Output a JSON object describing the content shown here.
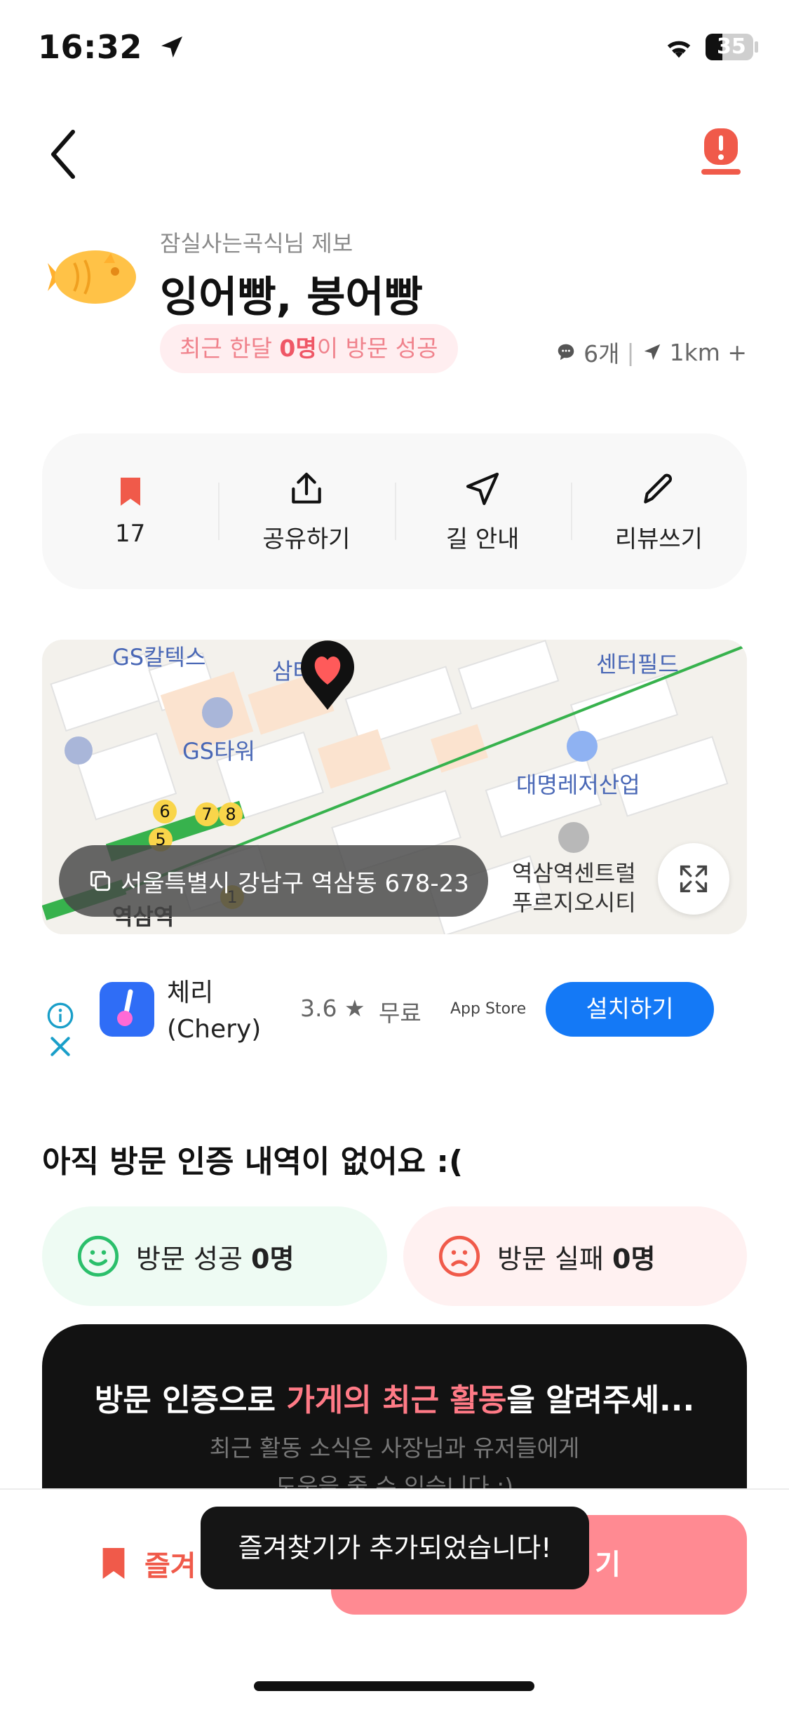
{
  "status_bar": {
    "time": "16:32",
    "battery": "35"
  },
  "header": {
    "back_icon": "chevron-left-icon",
    "report_icon": "alert-icon"
  },
  "store": {
    "tipster": "잠실사는곡식님 제보",
    "name": "잉어빵, 붕어빵",
    "visit_pill_prefix": "최근 한달 ",
    "visit_pill_count": "0명",
    "visit_pill_suffix": "이 방문 성공",
    "review_count": "6개",
    "distance": "1km +"
  },
  "actions": [
    {
      "icon": "bookmark-icon",
      "label": "17"
    },
    {
      "icon": "share-icon",
      "label": "공유하기"
    },
    {
      "icon": "navigation-icon",
      "label": "길 안내"
    },
    {
      "icon": "pencil-icon",
      "label": "리뷰쓰기"
    }
  ],
  "map": {
    "labels": [
      "GS칼텍스",
      "삼타워",
      "센터필드",
      "GS타워",
      "대명레저산업",
      "역삼역센트럴",
      "푸르지오시티",
      "역삼역"
    ],
    "exits": [
      "6",
      "7",
      "8",
      "5",
      "1"
    ],
    "address": "서울특별시 강남구 역삼동 678-23"
  },
  "ad": {
    "app_name_line1": "체리",
    "app_name_line2": "(Chery)",
    "rating": "3.6 ★",
    "price": "무료",
    "store": "App Store",
    "install": "설치하기"
  },
  "visits": {
    "heading": "아직 방문 인증 내역이 없어요 :(",
    "success_label": "방문 성공 ",
    "success_count": "0명",
    "fail_label": "방문 실패 ",
    "fail_count": "0명"
  },
  "promo": {
    "title_part1": "방문 인증으로 ",
    "title_highlight": "가게의 최근 활동",
    "title_part2": "을 알려주세...",
    "sub1": "최근 활동 소식은 사장님과 유저들에게",
    "sub2": "도움을 줄 수 있습니다 :)"
  },
  "bottom": {
    "favorite_label": "즐겨",
    "verify_label": "기",
    "toast": "즐겨찾기가 추가되었습니다!"
  },
  "colors": {
    "accent": "#f05a4a",
    "pink": "#ff8a92",
    "install_blue": "#1479f6",
    "success_green": "#2bbf6b",
    "fail_red": "#f05a4a"
  }
}
